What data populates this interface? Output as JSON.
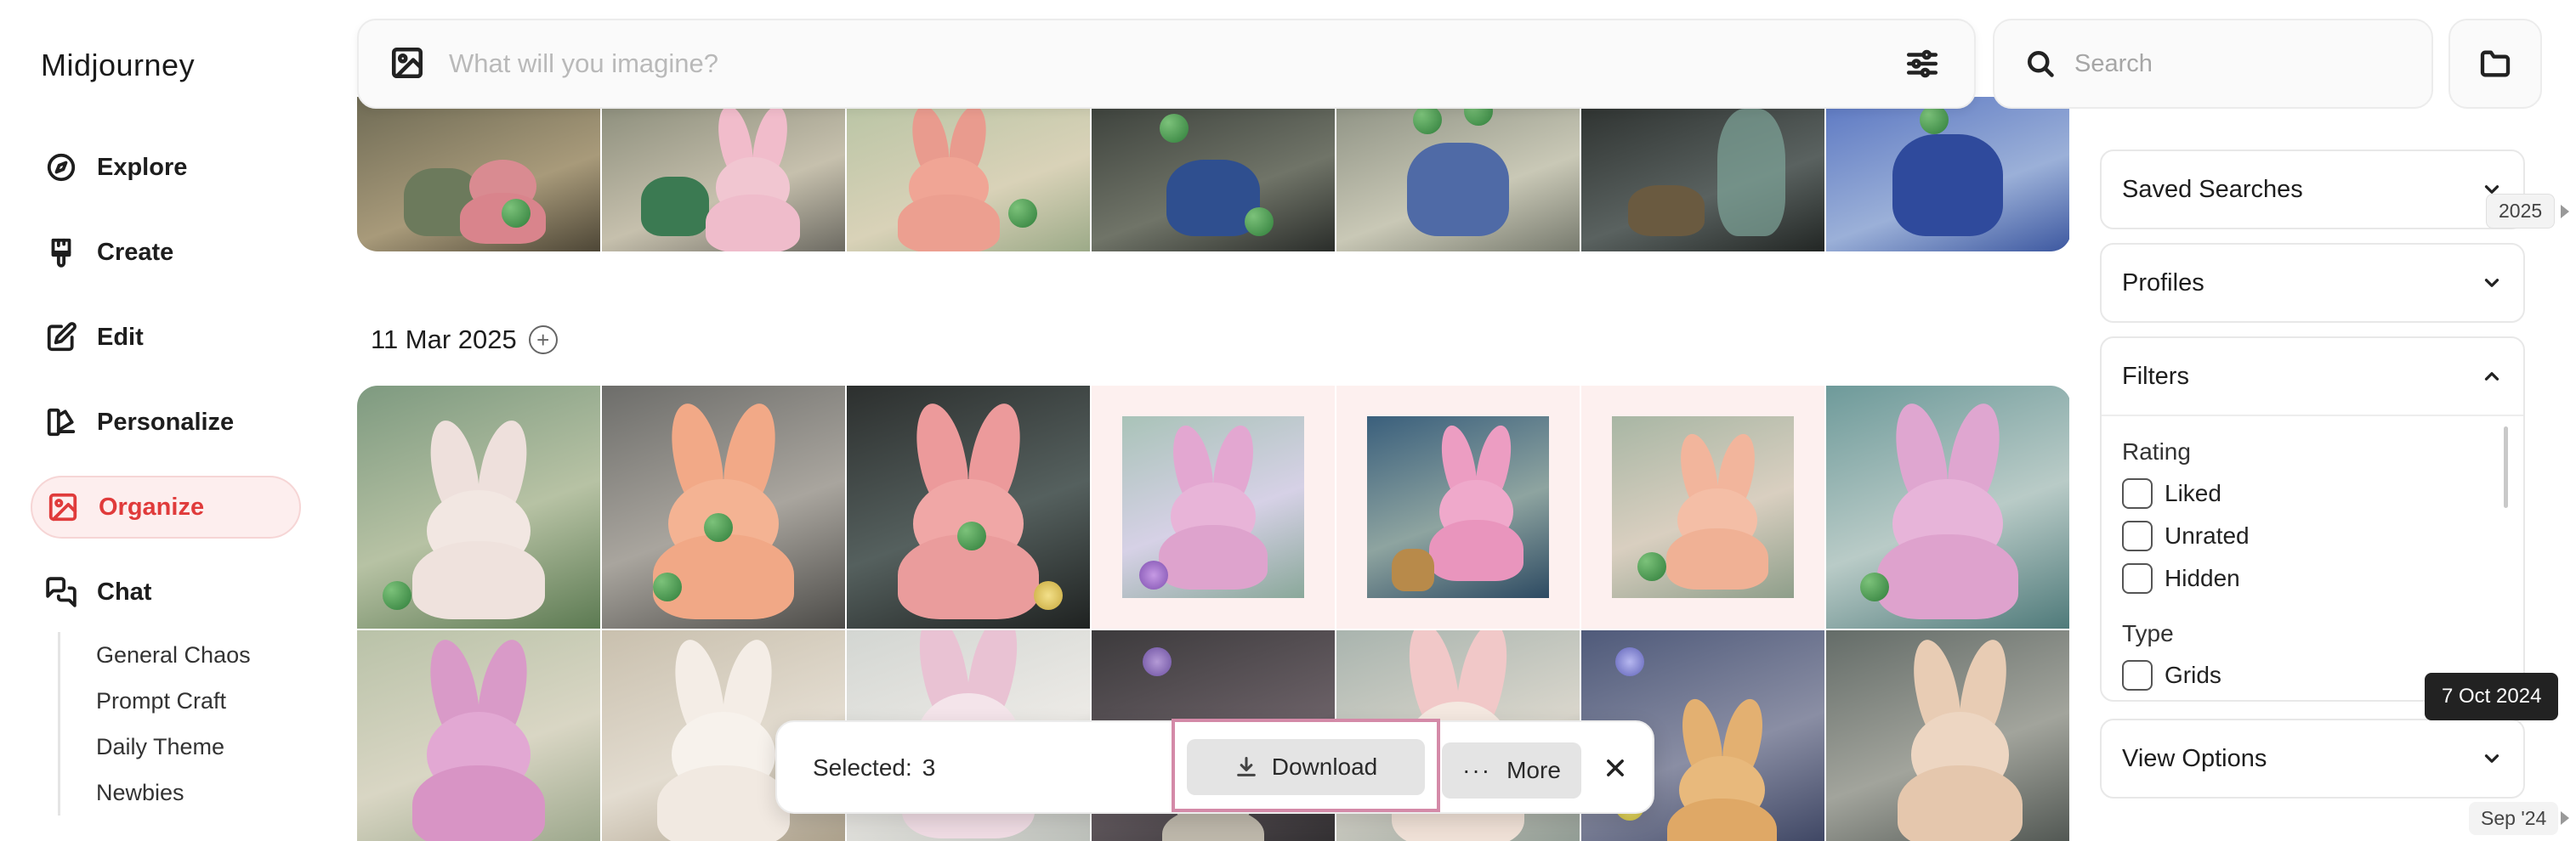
{
  "sidebar": {
    "brand": "Midjourney",
    "items": [
      {
        "label": "Explore",
        "icon": "compass-icon"
      },
      {
        "label": "Create",
        "icon": "brush-icon"
      },
      {
        "label": "Edit",
        "icon": "edit-icon"
      },
      {
        "label": "Personalize",
        "icon": "personalize-icon"
      },
      {
        "label": "Organize",
        "icon": "image-icon",
        "active": true
      },
      {
        "label": "Chat",
        "icon": "chat-icon"
      }
    ],
    "chat_rooms": [
      "General Chaos",
      "Prompt Craft",
      "Daily Theme",
      "Newbies"
    ]
  },
  "prompt": {
    "placeholder": "What will you imagine?"
  },
  "search": {
    "placeholder": "Search"
  },
  "gallery": {
    "date_heading": "11 Mar 2025",
    "selected_tiles": [
      3,
      4,
      5
    ]
  },
  "right_panel": {
    "saved_searches": "Saved Searches",
    "profiles": "Profiles",
    "filters": {
      "title": "Filters",
      "rating_label": "Rating",
      "rating_options": [
        "Liked",
        "Unrated",
        "Hidden"
      ],
      "type_label": "Type",
      "type_options": [
        "Grids"
      ]
    },
    "view_options": "View Options"
  },
  "timeline": {
    "top": "2025",
    "hover": "7 Oct 2024",
    "bottom": "Sep '24"
  },
  "selection_bar": {
    "selected_label": "Selected:",
    "selected_count": "3",
    "download": "Download",
    "more": "More"
  },
  "colors": {
    "accent": "#e03b3b",
    "accent_bg": "#fdeeee",
    "highlight_border": "#d48aa8"
  }
}
